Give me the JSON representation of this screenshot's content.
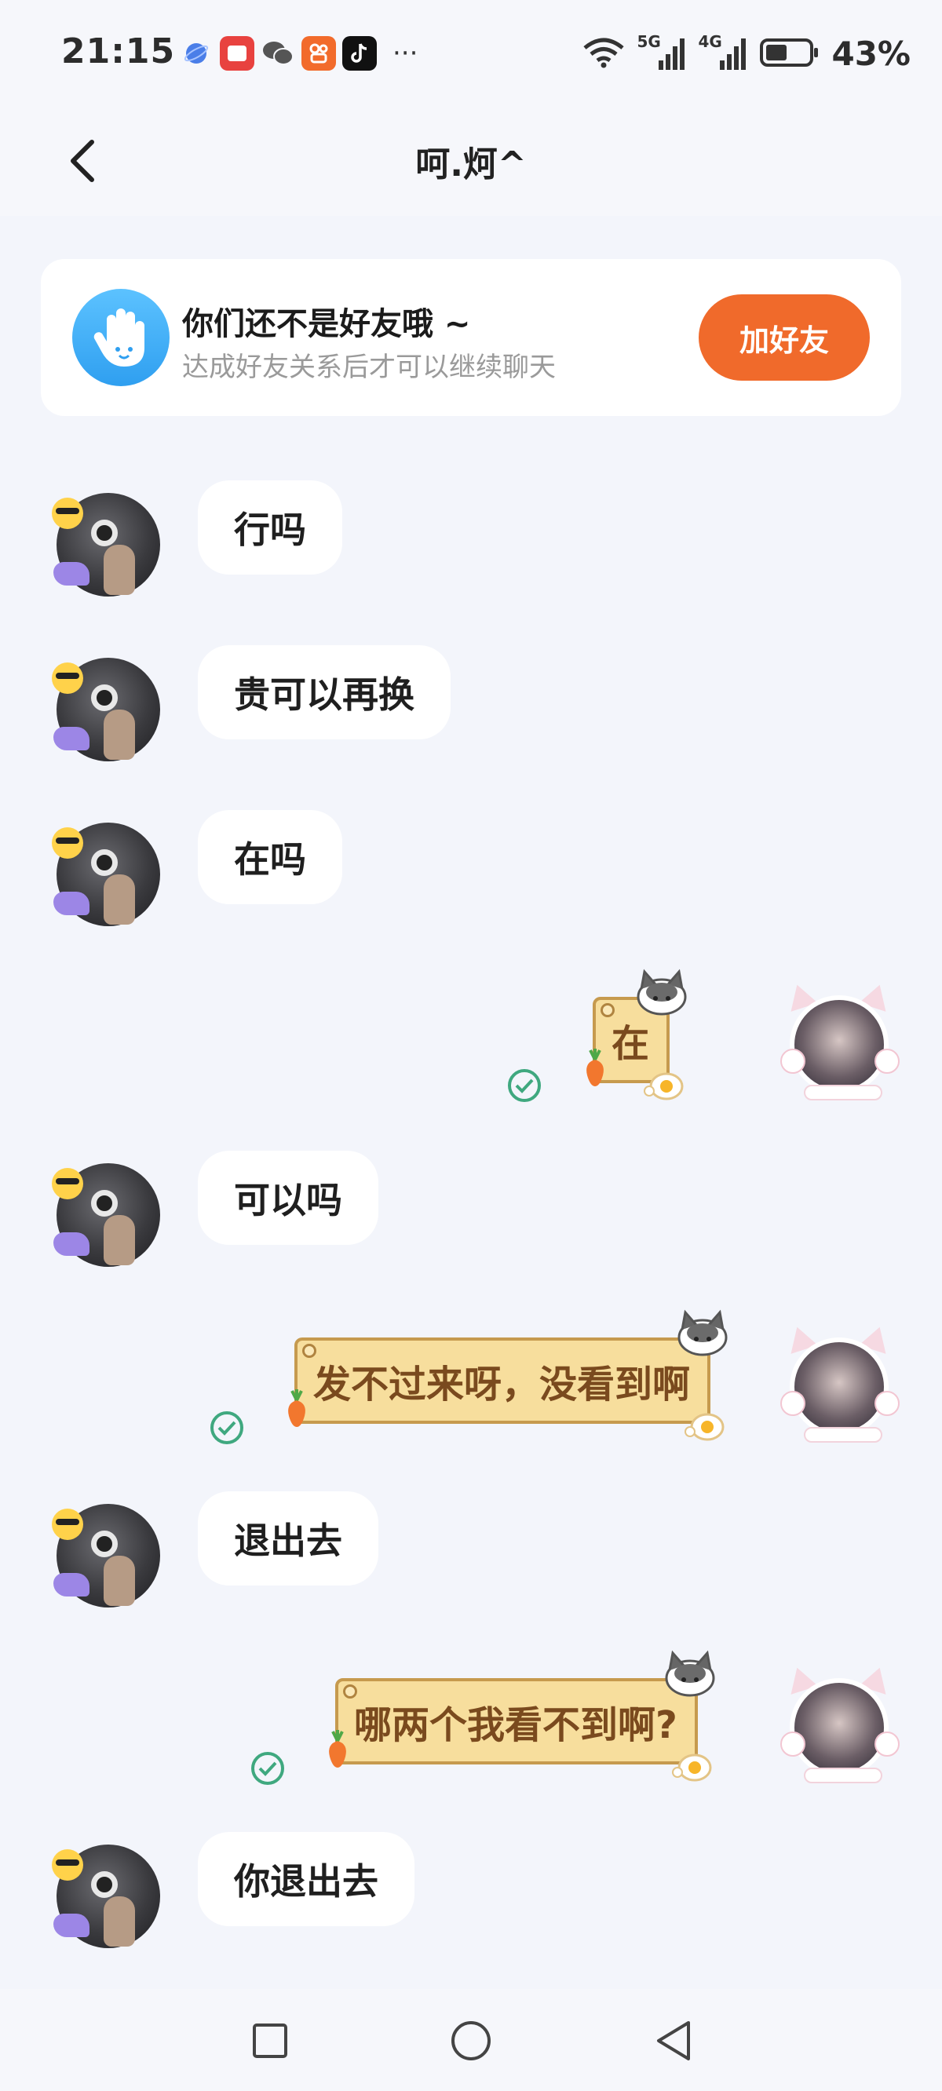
{
  "status_bar": {
    "time": "21:15",
    "battery": "43%",
    "more_dots": "···",
    "signal_5g_label": "5G",
    "signal_4g_label": "4G"
  },
  "header": {
    "title": "呵.炣^"
  },
  "banner": {
    "title": "你们还不是好友哦 ~",
    "subtitle": "达成好友关系后才可以继续聊天",
    "button_label": "加好友",
    "accent_color": "#f06a2b"
  },
  "messages": [
    {
      "side": "left",
      "text": "行吗"
    },
    {
      "side": "left",
      "text": "贵可以再换"
    },
    {
      "side": "left",
      "text": "在吗"
    },
    {
      "side": "right",
      "text": "在",
      "read": true
    },
    {
      "side": "left",
      "text": "可以吗"
    },
    {
      "side": "right",
      "text": "发不过来呀，没看到啊",
      "read": true
    },
    {
      "side": "left",
      "text": "退出去"
    },
    {
      "side": "right",
      "text": "哪两个我看不到啊?",
      "read": true
    },
    {
      "side": "left",
      "text": "你退出去"
    }
  ],
  "nav_bar": {
    "recents": "recents-icon",
    "home": "home-icon",
    "back": "back-triangle-icon"
  }
}
